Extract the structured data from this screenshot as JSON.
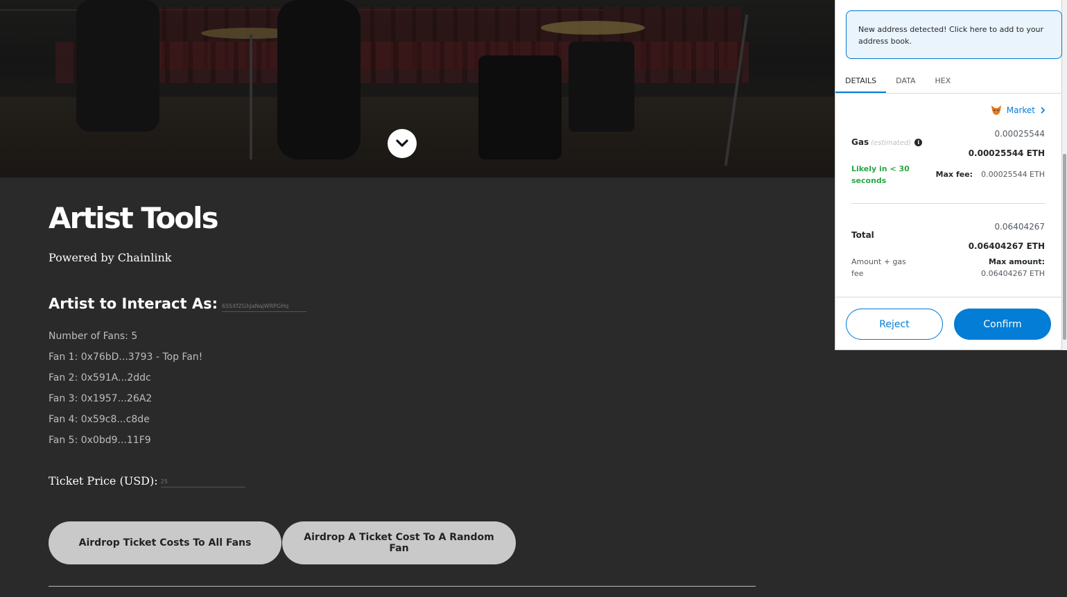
{
  "hero": {
    "scroll_icon": "chevron-down-icon"
  },
  "main": {
    "title": "Artist Tools",
    "subtitle": "Powered by Chainlink",
    "artist_label": "Artist to Interact As:",
    "artist_input_placeholder": "6SSXfZGhJaNajWRPGHq",
    "fans": [
      "Number of Fans: 5",
      "Fan 1: 0x76bD...3793 - Top Fan!",
      "Fan 2: 0x591A...2ddc",
      "Fan 3: 0x1957...26A2",
      "Fan 4: 0x59c8...c8de",
      "Fan 5: 0x0bd9...11F9"
    ],
    "price_label": "Ticket Price (USD):",
    "price_input_placeholder": "25",
    "buttons": {
      "airdrop_all": "Airdrop Ticket Costs To All Fans",
      "airdrop_random": "Airdrop A Ticket Cost To A Random Fan"
    }
  },
  "metamask": {
    "notice": "New address detected! Click here to add to your address book.",
    "tabs": [
      "DETAILS",
      "DATA",
      "HEX"
    ],
    "active_tab": "DETAILS",
    "market": "Market",
    "gas_label": "Gas",
    "gas_estimated": "(estimated)",
    "gas_value": "0.00025544",
    "gas_eth": "0.00025544 ETH",
    "likely": "Likely in < 30 seconds",
    "max_fee_label": "Max fee:",
    "max_fee_value": "0.00025544 ETH",
    "total_label": "Total",
    "total_value": "0.06404267",
    "total_eth": "0.06404267 ETH",
    "amount_gas_fee": "Amount + gas fee",
    "max_amount_label": "Max amount:",
    "max_amount_value": "0.06404267 ETH",
    "reject": "Reject",
    "confirm": "Confirm",
    "colors": {
      "accent": "#037dd6",
      "success": "#28a745",
      "notice_bg": "#eaf4fc"
    }
  }
}
